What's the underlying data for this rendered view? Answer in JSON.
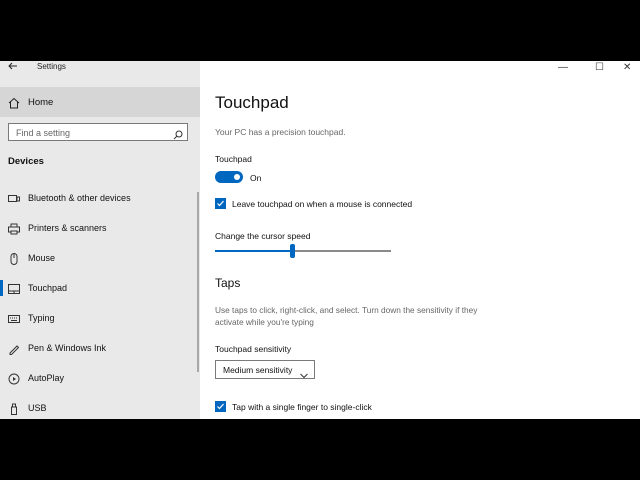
{
  "window": {
    "app_title": "Settings",
    "controls": {
      "minimize": "—",
      "maximize": "☐",
      "close": "✕"
    }
  },
  "sidebar": {
    "home_label": "Home",
    "search": {
      "placeholder": "Find a setting"
    },
    "section_title": "Devices",
    "items": [
      {
        "label": "Bluetooth & other devices",
        "icon": "bluetooth-devices-icon"
      },
      {
        "label": "Printers & scanners",
        "icon": "printer-icon"
      },
      {
        "label": "Mouse",
        "icon": "mouse-icon"
      },
      {
        "label": "Touchpad",
        "icon": "touchpad-icon",
        "active": true
      },
      {
        "label": "Typing",
        "icon": "keyboard-icon"
      },
      {
        "label": "Pen & Windows Ink",
        "icon": "pen-icon"
      },
      {
        "label": "AutoPlay",
        "icon": "autoplay-icon"
      },
      {
        "label": "USB",
        "icon": "usb-icon"
      }
    ]
  },
  "main": {
    "title": "Touchpad",
    "subtitle": "Your PC has a precision touchpad.",
    "touchpad_label": "Touchpad",
    "touchpad_state": "On",
    "leave_on_label": "Leave touchpad on when a mouse is connected",
    "cursor_speed_label": "Change the cursor speed",
    "cursor_speed_fraction": 0.44,
    "taps_heading": "Taps",
    "taps_description": "Use taps to click, right-click, and select. Turn down the sensitivity if they activate while you're typing",
    "sensitivity_label": "Touchpad sensitivity",
    "sensitivity_value": "Medium sensitivity",
    "single_tap_label": "Tap with a single finger to single-click"
  },
  "colors": {
    "accent": "#0067c0",
    "sidebar_bg": "#e9e9e9",
    "selected_bg": "#d6d6d6"
  }
}
